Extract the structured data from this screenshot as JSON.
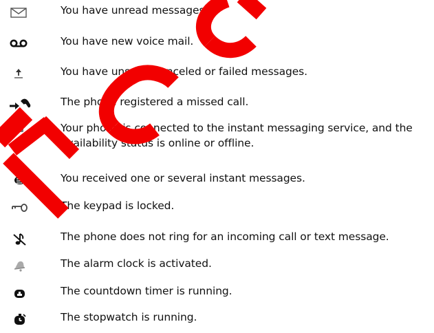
{
  "watermark_text": "FCC",
  "colors": {
    "watermark": "#f20000",
    "text": "#111111",
    "icon": "#222222"
  },
  "items": [
    {
      "icon": "envelope-icon",
      "text": "You have unread messages."
    },
    {
      "icon": "voicemail-icon",
      "text": "You have new voice mail."
    },
    {
      "icon": "outbox-icon",
      "text": "You have unsent, canceled or failed messages."
    },
    {
      "icon": "missed-call-icon",
      "text": "The phone registered a missed call."
    },
    {
      "icon": "instant-messaging-status-icons",
      "text": "Your phone is connected to the instant messaging service, and the availability status is online or offline."
    },
    {
      "icon": "instant-message-icon",
      "text": "You received one or several instant messages."
    },
    {
      "icon": "key-icon",
      "text": "The keypad is locked."
    },
    {
      "icon": "silent-icon",
      "text": "The phone does not ring for an incoming call or text message."
    },
    {
      "icon": "alarm-bell-icon",
      "text": "The alarm clock is activated."
    },
    {
      "icon": "countdown-timer-icon",
      "text": "The countdown timer is running."
    },
    {
      "icon": "stopwatch-icon",
      "text": "The stopwatch is running."
    }
  ]
}
